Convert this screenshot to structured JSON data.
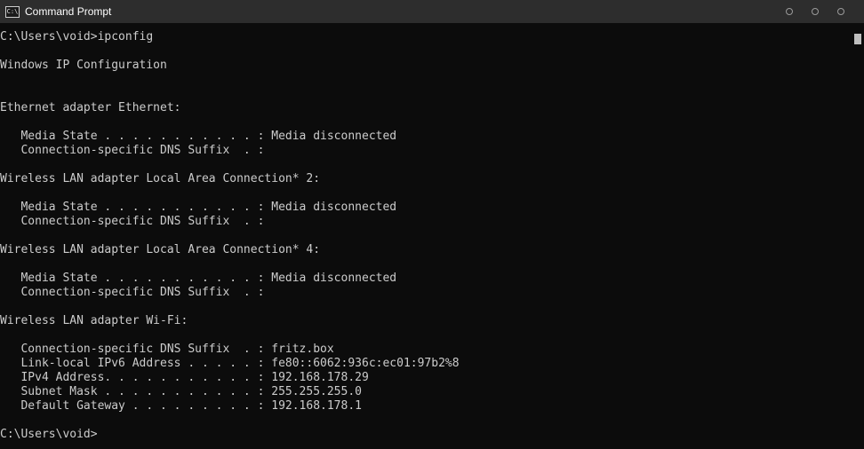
{
  "window": {
    "title": "Command Prompt",
    "icon_text": "C:\\",
    "icon": "console-window-icon",
    "controls": [
      "minimize-icon",
      "maximize-icon",
      "close-icon"
    ]
  },
  "console": {
    "lines": [
      "C:\\Users\\void>ipconfig",
      "",
      "Windows IP Configuration",
      "",
      "",
      "Ethernet adapter Ethernet:",
      "",
      "   Media State . . . . . . . . . . . : Media disconnected",
      "   Connection-specific DNS Suffix  . :",
      "",
      "Wireless LAN adapter Local Area Connection* 2:",
      "",
      "   Media State . . . . . . . . . . . : Media disconnected",
      "   Connection-specific DNS Suffix  . :",
      "",
      "Wireless LAN adapter Local Area Connection* 4:",
      "",
      "   Media State . . . . . . . . . . . : Media disconnected",
      "   Connection-specific DNS Suffix  . :",
      "",
      "Wireless LAN adapter Wi-Fi:",
      "",
      "   Connection-specific DNS Suffix  . : fritz.box",
      "   Link-local IPv6 Address . . . . . : fe80::6062:936c:ec01:97b2%8",
      "   IPv4 Address. . . . . . . . . . . : 192.168.178.29",
      "   Subnet Mask . . . . . . . . . . . : 255.255.255.0",
      "   Default Gateway . . . . . . . . . : 192.168.178.1",
      "",
      "C:\\Users\\void>"
    ]
  },
  "colors": {
    "background": "#0c0c0c",
    "text": "#cccccc",
    "titlebar": "#2d2d2d"
  }
}
